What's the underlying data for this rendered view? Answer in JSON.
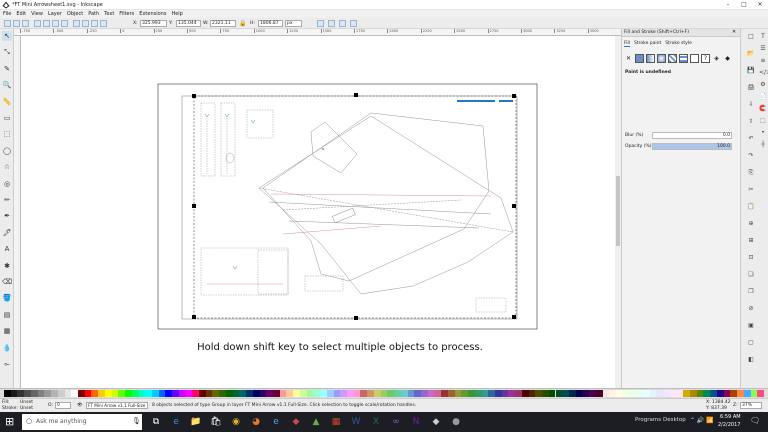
{
  "window": {
    "title": "*FT Mini Arrowsheet1.svg - Inkscape",
    "minimize_glyph": "–",
    "maximize_glyph": "□",
    "close_glyph": "✕"
  },
  "menu": [
    "File",
    "Edit",
    "View",
    "Layer",
    "Object",
    "Path",
    "Text",
    "Filters",
    "Extensions",
    "Help"
  ],
  "controls": {
    "x_label": "X:",
    "x_value": "325.993",
    "y_label": "Y:",
    "y_value": "135.044",
    "w_label": "W:",
    "w_value": "2321.11",
    "h_label": "H:",
    "h_value": "1806.87",
    "unit": "px"
  },
  "ruler_ticks": [
    "-750",
    "-500",
    "-250",
    "0",
    "250",
    "500",
    "750",
    "1000",
    "1250",
    "1500",
    "1750",
    "2000",
    "2250",
    "2500",
    "2750",
    "3000",
    "3250",
    "3500"
  ],
  "tools": [
    "select-tool",
    "node-tool",
    "tweak-tool",
    "zoom-tool",
    "measure-tool",
    "rectangle-tool",
    "3d-box-tool",
    "ellipse-tool",
    "star-tool",
    "spiral-tool",
    "pencil-tool",
    "pen-tool",
    "calligraphy-tool",
    "text-tool",
    "spray-tool",
    "eraser-tool",
    "bucket-tool",
    "gradient-tool",
    "mesh-tool",
    "dropper-tool",
    "connector-tool"
  ],
  "tool_glyphs": [
    "↖",
    "⤡",
    "✎",
    "🔍",
    "📏",
    "▭",
    "⬚",
    "◯",
    "☆",
    "◎",
    "✏",
    "✒",
    "🖋",
    "A",
    "✱",
    "⌫",
    "🪣",
    "▤",
    "▦",
    "💧",
    "⟜"
  ],
  "dock": {
    "title": "Fill and Stroke (Shift+Ctrl+F)",
    "tabs": [
      "Fill",
      "Stroke paint",
      "Stroke style"
    ],
    "paint_undefined": "Paint is undefined",
    "blur_label": "Blur (%)",
    "blur_value": "0.0",
    "opacity_label": "Opacity (%)",
    "opacity_value": "100.0"
  },
  "caption": "Hold down shift key to select multiple objects to process.",
  "status": {
    "fill_label": "Fill:",
    "fill_value": "Unset",
    "stroke_label": "Stroke:",
    "stroke_value": "Unset",
    "opacity_o": "O:",
    "opacity_value": "0",
    "layer": "FT Mini Arrow v1.1 Full-Size",
    "message": "8 objects selected of type Group in layer FT Mini Arrow v1.1 Full-Size. Click selection to toggle scale/rotation handles.",
    "coords_x": "X: 1384.42",
    "coords_y": "Y: 837.39",
    "zoom_label": "Z:",
    "zoom_value": "37%"
  },
  "taskbar": {
    "search": "Ask me anything",
    "programs": "Programs",
    "desktop": "Desktop",
    "time": "6:59 AM",
    "date": "2/2/2017"
  },
  "colors": {
    "palette": [
      "#000000",
      "#1a1a1a",
      "#333333",
      "#4d4d4d",
      "#666666",
      "#808080",
      "#999999",
      "#b3b3b3",
      "#cccccc",
      "#e6e6e6",
      "#ffffff",
      "#800000",
      "#ff0000",
      "#ff6600",
      "#ffcc00",
      "#ffff00",
      "#ccff00",
      "#66ff00",
      "#00ff00",
      "#00ff66",
      "#00ffcc",
      "#00ffff",
      "#00ccff",
      "#0066ff",
      "#0000ff",
      "#6600ff",
      "#cc00ff",
      "#ff00ff",
      "#ff0066",
      "#660000",
      "#663300",
      "#666600",
      "#336600",
      "#006600",
      "#006633",
      "#006666",
      "#003366",
      "#000066",
      "#330066",
      "#660066",
      "#660033",
      "#ff9999",
      "#ffcc99",
      "#ffff99",
      "#ccff99",
      "#99ff99",
      "#99ffcc",
      "#99ffff",
      "#99ccff",
      "#9999ff",
      "#cc99ff",
      "#ff99ff",
      "#ff99cc",
      "#cc6666",
      "#cc9966",
      "#cccc66",
      "#99cc66",
      "#66cc66",
      "#66cc99",
      "#66cccc",
      "#6699cc",
      "#6666cc",
      "#9966cc",
      "#cc66cc",
      "#cc6699",
      "#993333",
      "#996633",
      "#999933",
      "#669933",
      "#339933",
      "#339966",
      "#339999",
      "#336699",
      "#333399",
      "#663399",
      "#993399",
      "#993366",
      "#4d0000",
      "#4d2600",
      "#4d4d00",
      "#264d00",
      "#004d00",
      "#004d26",
      "#004d4d",
      "#00264d",
      "#00004d",
      "#26004d",
      "#4d004d",
      "#4d0026",
      "#ffe6e6",
      "#fff2e6",
      "#ffffe6",
      "#f2ffe6",
      "#e6ffe6",
      "#e6fff2",
      "#e6ffff",
      "#e6f2ff",
      "#e6e6ff",
      "#f2e6ff",
      "#ffe6ff",
      "#ffe6f2",
      "#d4aa00",
      "#aa8800",
      "#558800",
      "#008855",
      "#005588",
      "#220088",
      "#880055",
      "#aa4400",
      "#ff8844",
      "#44aaff",
      "#88ff44",
      "#ff4488"
    ],
    "selection": "#000000",
    "guide_red": "#e07070",
    "accent": "#1f78c8"
  }
}
